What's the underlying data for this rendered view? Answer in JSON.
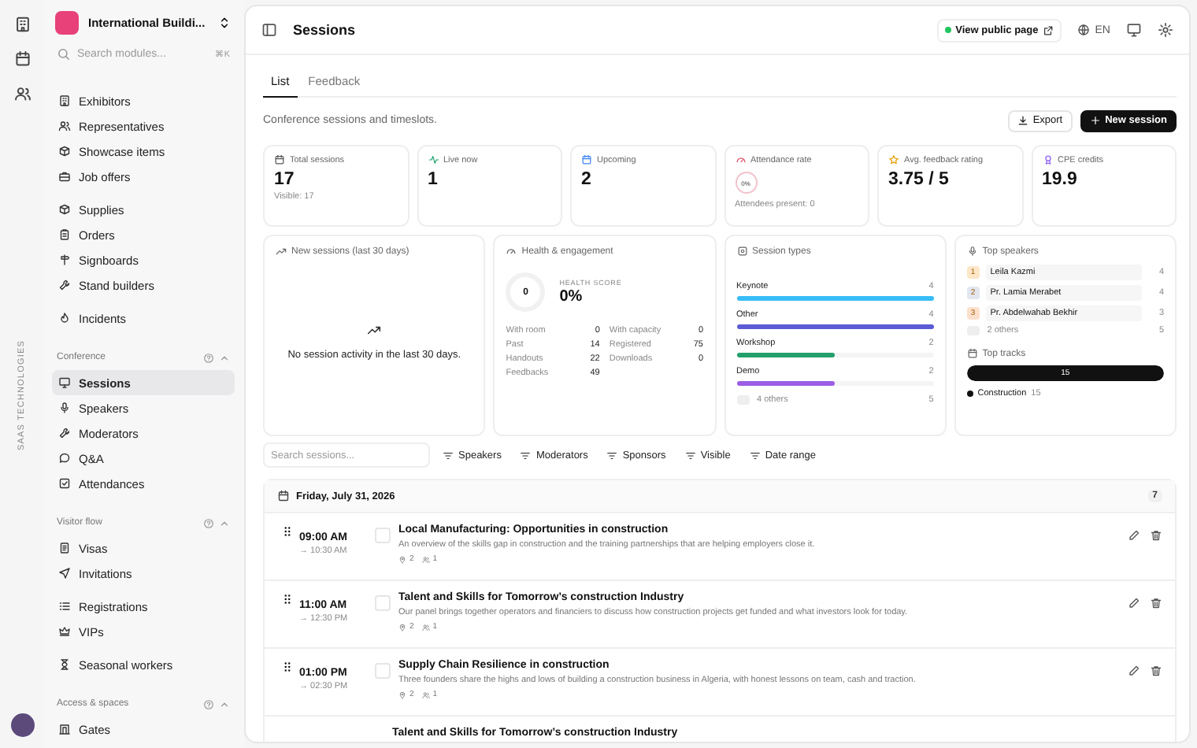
{
  "rail": {
    "brand": "SAAS TECHNOLOGIES"
  },
  "sidebar": {
    "org": "International Buildi...",
    "search": {
      "placeholder": "Search modules...",
      "shortcut": "⌘K"
    },
    "groups": [
      {
        "items": [
          {
            "label": "Exhibitors",
            "selected": false
          },
          {
            "label": "Representatives",
            "selected": false
          },
          {
            "label": "Showcase items",
            "selected": false
          },
          {
            "label": "Job offers",
            "selected": false
          }
        ]
      },
      {
        "items": [
          {
            "label": "Supplies",
            "selected": false
          },
          {
            "label": "Orders",
            "selected": false
          },
          {
            "label": "Signboards",
            "selected": false
          },
          {
            "label": "Stand builders",
            "selected": false
          }
        ]
      },
      {
        "items": [
          {
            "label": "Incidents",
            "selected": false
          }
        ]
      },
      {
        "title": "Conference",
        "expanded": true,
        "items": [
          {
            "label": "Sessions",
            "selected": true
          },
          {
            "label": "Speakers",
            "selected": false
          },
          {
            "label": "Moderators",
            "selected": false
          },
          {
            "label": "Q&A",
            "selected": false
          },
          {
            "label": "Attendances",
            "selected": false
          }
        ]
      },
      {
        "title": "Visitor flow",
        "expanded": true,
        "items": [
          {
            "label": "Visas",
            "selected": false
          },
          {
            "label": "Invitations",
            "selected": false
          }
        ]
      },
      {
        "items": [
          {
            "label": "Registrations",
            "selected": false
          },
          {
            "label": "VIPs",
            "selected": false
          }
        ]
      },
      {
        "items": [
          {
            "label": "Seasonal workers",
            "selected": false
          }
        ]
      },
      {
        "title": "Access & spaces",
        "expanded": true,
        "items": [
          {
            "label": "Gates",
            "selected": false
          }
        ]
      }
    ]
  },
  "header": {
    "title": "Sessions",
    "public_link": "View public page",
    "language": "EN"
  },
  "tabs": [
    {
      "label": "List",
      "selected": true
    },
    {
      "label": "Feedback",
      "selected": false
    }
  ],
  "description": "Conference sessions and timeslots.",
  "actions": {
    "export": "Export",
    "new": "New session"
  },
  "stats": [
    {
      "kind": "value",
      "label": "Total sessions",
      "value": "17",
      "note": "Visible: 17"
    },
    {
      "kind": "value",
      "label": "Live now",
      "value": "1"
    },
    {
      "kind": "value",
      "label": "Upcoming",
      "value": "2"
    },
    {
      "kind": "ring",
      "label": "Attendance rate",
      "value": "0%",
      "note": "Attendees present: 0"
    },
    {
      "kind": "value",
      "label": "Avg. feedback rating",
      "value": "3.75 / 5"
    },
    {
      "kind": "value",
      "label": "CPE credits",
      "value": "19.9"
    }
  ],
  "new_sessions": {
    "title": "New sessions (last 30 days)",
    "empty": "No session activity in the last 30 days."
  },
  "health": {
    "title": "Health & engagement",
    "ring": "0",
    "score_label": "HEALTH SCORE",
    "score": "0%",
    "metrics": [
      {
        "label": "With room",
        "value": "0"
      },
      {
        "label": "With capacity",
        "value": "0"
      },
      {
        "label": "Past",
        "value": "14"
      },
      {
        "label": "Registered",
        "value": "75"
      },
      {
        "label": "Handouts",
        "value": "22"
      },
      {
        "label": "Downloads",
        "value": "0"
      },
      {
        "label": "Feedbacks",
        "value": "49"
      }
    ]
  },
  "session_types": {
    "title": "Session types",
    "items": [
      {
        "label": "Keynote",
        "count": "4",
        "level": 1,
        "color": "#38bdf8"
      },
      {
        "label": "Other",
        "count": "4",
        "level": 1,
        "color": "#5b5bd6"
      },
      {
        "label": "Workshop",
        "count": "2",
        "level": 0.5,
        "color": "#22a06b"
      },
      {
        "label": "Demo",
        "count": "2",
        "level": 0.5,
        "color": "#9b5de5"
      }
    ],
    "others": {
      "label": "4 others",
      "count": "5"
    }
  },
  "top_speakers": {
    "title": "Top speakers",
    "items": [
      {
        "rank": "1",
        "name": "Leila Kazmi",
        "count": "4",
        "color": "#fde7c7"
      },
      {
        "rank": "2",
        "name": "Pr. Lamia Merabet",
        "count": "4",
        "color": "#e2e6ef"
      },
      {
        "rank": "3",
        "name": "Pr. Abdelwahab Bekhir",
        "count": "3",
        "color": "#fde0cc"
      }
    ],
    "others": {
      "label": "2 others",
      "count": "5"
    }
  },
  "top_tracks": {
    "title": "Top tracks",
    "bar": {
      "label": "15",
      "level": 1
    },
    "legend": [
      {
        "label": "Construction",
        "count": "15",
        "color": "#111111"
      }
    ]
  },
  "filters": {
    "search_placeholder": "Search sessions...",
    "buttons": [
      "Speakers",
      "Moderators",
      "Sponsors",
      "Visible",
      "Date range"
    ]
  },
  "day": {
    "date": "Friday, July 31, 2026",
    "count": "7",
    "sessions": [
      {
        "start": "09:00 AM",
        "end": "→ 10:30 AM",
        "checked": false,
        "title": "Local Manufacturing: Opportunities in construction",
        "description": "An overview of the skills gap in construction and the training partnerships that are helping employers close it.",
        "speakers": "2",
        "moderators": "1"
      },
      {
        "start": "11:00 AM",
        "end": "→ 12:30 PM",
        "checked": false,
        "title": "Talent and Skills for Tomorrow’s construction Industry",
        "description": "Our panel brings together operators and financiers to discuss how construction projects get funded and what investors look for today.",
        "speakers": "2",
        "moderators": "1"
      },
      {
        "start": "01:00 PM",
        "end": "→ 02:30 PM",
        "checked": false,
        "title": "Supply Chain Resilience in construction",
        "description": "Three founders share the highs and lows of building a construction business in Algeria, with honest lessons on team, cash and traction.",
        "speakers": "2",
        "moderators": "1"
      },
      {
        "title": "Talent and Skills for Tomorrow’s construction Industry"
      }
    ]
  }
}
